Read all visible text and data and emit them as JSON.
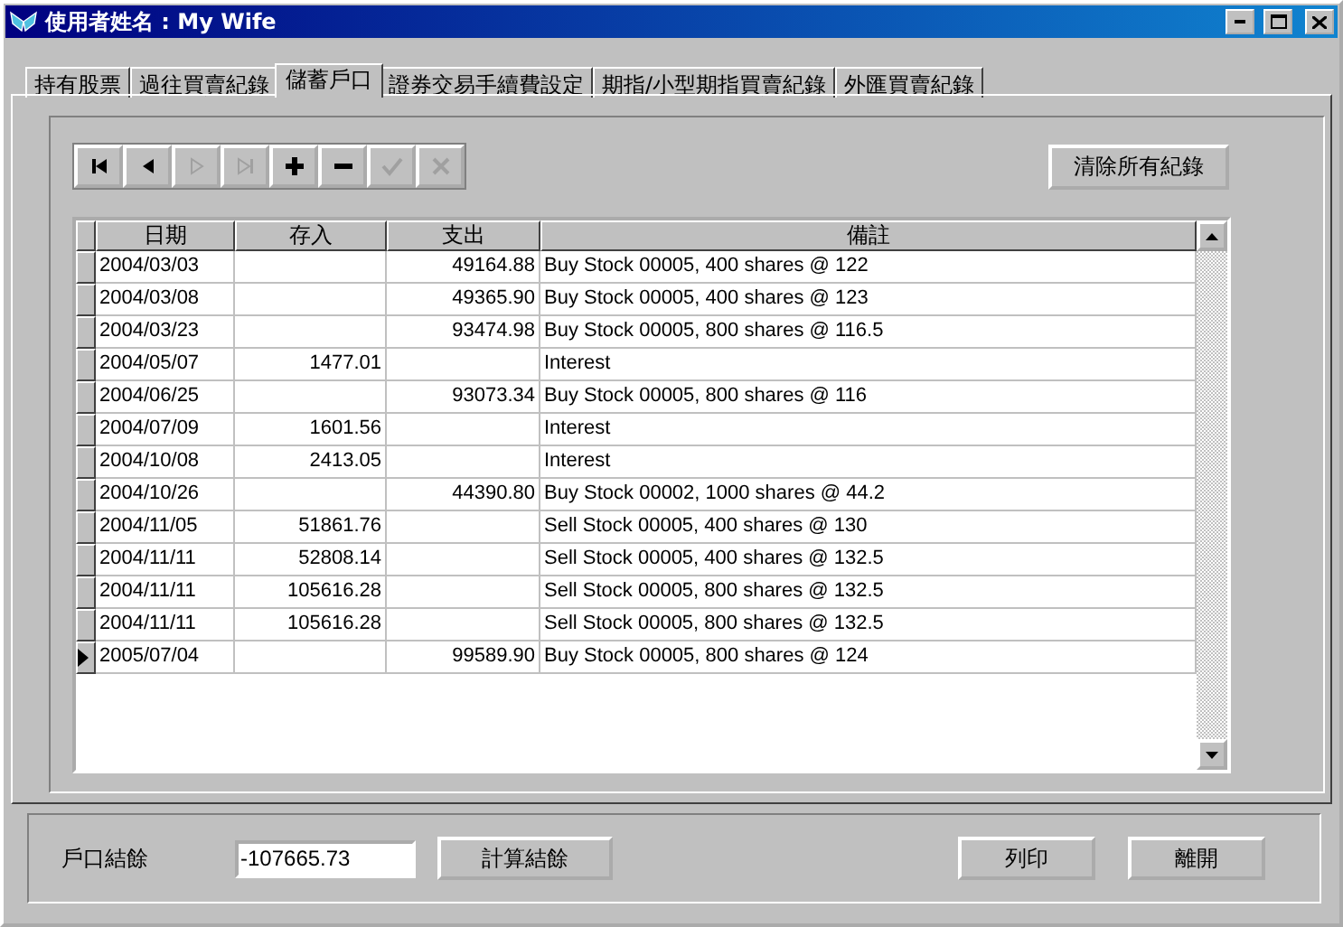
{
  "window": {
    "title": "使用者姓名 : My Wife"
  },
  "tabs": [
    {
      "label": "持有股票",
      "selected": false
    },
    {
      "label": "過往買賣紀錄",
      "selected": false
    },
    {
      "label": "儲蓄戶口",
      "selected": true
    },
    {
      "label": "證券交易手續費設定",
      "selected": false
    },
    {
      "label": "期指/小型期指買賣紀錄",
      "selected": false
    },
    {
      "label": "外匯買賣紀錄",
      "selected": false
    }
  ],
  "navigator": [
    {
      "kind": "first",
      "disabled": false
    },
    {
      "kind": "prior",
      "disabled": false
    },
    {
      "kind": "next",
      "disabled": true
    },
    {
      "kind": "last",
      "disabled": true
    },
    {
      "kind": "insert",
      "disabled": false
    },
    {
      "kind": "delete",
      "disabled": false
    },
    {
      "kind": "post",
      "disabled": true
    },
    {
      "kind": "cancel",
      "disabled": true
    }
  ],
  "clear_button": "清除所有紀錄",
  "table": {
    "columns": [
      "日期",
      "存入",
      "支出",
      "備註"
    ],
    "rows": [
      {
        "cells": [
          "2004/03/03",
          "",
          "49164.88",
          "Buy Stock 00005, 400 shares @ 122"
        ],
        "selected": false
      },
      {
        "cells": [
          "2004/03/08",
          "",
          "49365.90",
          "Buy Stock 00005, 400 shares @ 123"
        ],
        "selected": false
      },
      {
        "cells": [
          "2004/03/23",
          "",
          "93474.98",
          "Buy Stock 00005, 800 shares @ 116.5"
        ],
        "selected": false
      },
      {
        "cells": [
          "2004/05/07",
          "1477.01",
          "",
          "Interest"
        ],
        "selected": false
      },
      {
        "cells": [
          "2004/06/25",
          "",
          "93073.34",
          "Buy Stock 00005, 800 shares @ 116"
        ],
        "selected": false
      },
      {
        "cells": [
          "2004/07/09",
          "1601.56",
          "",
          "Interest"
        ],
        "selected": false
      },
      {
        "cells": [
          "2004/10/08",
          "2413.05",
          "",
          "Interest"
        ],
        "selected": false
      },
      {
        "cells": [
          "2004/10/26",
          "",
          "44390.80",
          "Buy Stock 00002, 1000 shares @ 44.2"
        ],
        "selected": false
      },
      {
        "cells": [
          "2004/11/05",
          "51861.76",
          "",
          "Sell Stock 00005, 400 shares @ 130"
        ],
        "selected": false
      },
      {
        "cells": [
          "2004/11/11",
          "52808.14",
          "",
          "Sell Stock 00005, 400 shares @ 132.5"
        ],
        "selected": false
      },
      {
        "cells": [
          "2004/11/11",
          "105616.28",
          "",
          "Sell Stock 00005, 800 shares @ 132.5"
        ],
        "selected": false
      },
      {
        "cells": [
          "2004/11/11",
          "105616.28",
          "",
          "Sell Stock 00005, 800 shares @ 132.5"
        ],
        "selected": false
      },
      {
        "cells": [
          "2005/07/04",
          "",
          "99589.90",
          "Buy Stock 00005, 800 shares @ 124"
        ],
        "selected": true
      }
    ]
  },
  "balance": {
    "label": "戶口結餘",
    "value": "-107665.73"
  },
  "buttons": [
    "計算結餘",
    "列印",
    "離開"
  ]
}
